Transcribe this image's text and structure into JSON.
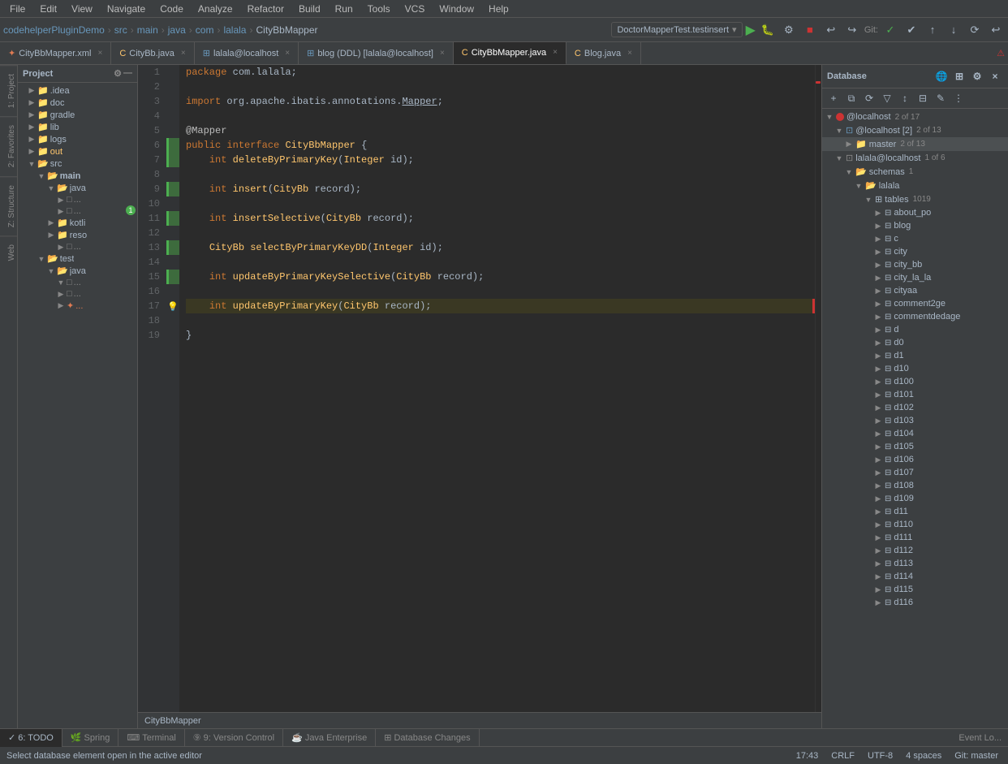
{
  "menu": {
    "items": [
      "File",
      "Edit",
      "View",
      "Navigate",
      "Code",
      "Analyze",
      "Refactor",
      "Build",
      "Run",
      "Tools",
      "VCS",
      "Window",
      "Help"
    ]
  },
  "toolbar": {
    "breadcrumbs": [
      {
        "text": "codehelperPluginDemo",
        "type": "project"
      },
      {
        "text": "src",
        "type": "folder"
      },
      {
        "text": "main",
        "type": "folder"
      },
      {
        "text": "java",
        "type": "folder"
      },
      {
        "text": "com",
        "type": "folder"
      },
      {
        "text": "lalala",
        "type": "folder"
      },
      {
        "text": "CityBbMapper",
        "type": "file"
      }
    ],
    "run_config": "DoctorMapperTest.testinsert",
    "git_label": "Git:"
  },
  "tabs": [
    {
      "label": "CityBbMapper.xml",
      "type": "xml",
      "active": false,
      "modified": false
    },
    {
      "label": "CityBb.java",
      "type": "java",
      "active": false,
      "modified": false
    },
    {
      "label": "lalala@localhost",
      "type": "db",
      "active": false,
      "modified": false
    },
    {
      "label": "blog (DDL) [lalala@localhost]",
      "type": "blog",
      "active": false,
      "modified": false
    },
    {
      "label": "CityBbMapper.java",
      "type": "java",
      "active": true,
      "modified": false
    },
    {
      "label": "Blog.java",
      "type": "java",
      "active": false,
      "modified": false
    }
  ],
  "project_tree": {
    "root": "codehelperPluginDemo",
    "items": [
      {
        "label": ".idea",
        "level": 1,
        "type": "folder",
        "expanded": false
      },
      {
        "label": "doc",
        "level": 1,
        "type": "folder",
        "expanded": false
      },
      {
        "label": "gradle",
        "level": 1,
        "type": "folder",
        "expanded": false
      },
      {
        "label": "lib",
        "level": 1,
        "type": "folder",
        "expanded": false
      },
      {
        "label": "logs",
        "level": 1,
        "type": "folder",
        "expanded": false
      },
      {
        "label": "out",
        "level": 1,
        "type": "folder",
        "expanded": false,
        "highlighted": true
      },
      {
        "label": "src",
        "level": 1,
        "type": "folder",
        "expanded": true
      },
      {
        "label": "main",
        "level": 2,
        "type": "folder",
        "expanded": true
      },
      {
        "label": "java",
        "level": 3,
        "type": "folder",
        "expanded": true
      },
      {
        "label": "...",
        "level": 4,
        "type": "file"
      },
      {
        "label": "...",
        "level": 4,
        "type": "file"
      },
      {
        "label": "kotli",
        "level": 3,
        "type": "folder",
        "expanded": false
      },
      {
        "label": "reso",
        "level": 3,
        "type": "folder",
        "expanded": false
      },
      {
        "label": "test",
        "level": 2,
        "type": "folder",
        "expanded": true
      },
      {
        "label": "java",
        "level": 3,
        "type": "folder",
        "expanded": true
      },
      {
        "label": "...",
        "level": 4,
        "type": "file"
      },
      {
        "label": "...",
        "level": 4,
        "type": "file"
      },
      {
        "label": "...",
        "level": 5,
        "type": "file"
      }
    ]
  },
  "code": {
    "filename": "CityBbMapper",
    "lines": [
      {
        "num": 1,
        "content": "package com.lalala;",
        "type": "normal",
        "gutter": ""
      },
      {
        "num": 2,
        "content": "",
        "type": "normal",
        "gutter": ""
      },
      {
        "num": 3,
        "content": "import org.apache.ibatis.annotations.Mapper;",
        "type": "normal",
        "gutter": ""
      },
      {
        "num": 4,
        "content": "",
        "type": "normal",
        "gutter": ""
      },
      {
        "num": 5,
        "content": "@Mapper",
        "type": "normal",
        "gutter": ""
      },
      {
        "num": 6,
        "content": "public interface CityBbMapper {",
        "type": "normal",
        "gutter": "change"
      },
      {
        "num": 7,
        "content": "    int deleteByPrimaryKey(Integer id);",
        "type": "normal",
        "gutter": "change"
      },
      {
        "num": 8,
        "content": "",
        "type": "normal",
        "gutter": ""
      },
      {
        "num": 9,
        "content": "    int insert(CityBb record);",
        "type": "normal",
        "gutter": "change"
      },
      {
        "num": 10,
        "content": "",
        "type": "normal",
        "gutter": ""
      },
      {
        "num": 11,
        "content": "    int insertSelective(CityBb record);",
        "type": "normal",
        "gutter": "change"
      },
      {
        "num": 12,
        "content": "",
        "type": "normal",
        "gutter": ""
      },
      {
        "num": 13,
        "content": "    CityBb selectByPrimaryKeyDD(Integer id);",
        "type": "normal",
        "gutter": "change"
      },
      {
        "num": 14,
        "content": "",
        "type": "normal",
        "gutter": ""
      },
      {
        "num": 15,
        "content": "    int updateByPrimaryKeySelective(CityBb record);",
        "type": "normal",
        "gutter": "change"
      },
      {
        "num": 16,
        "content": "",
        "type": "normal",
        "gutter": ""
      },
      {
        "num": 17,
        "content": "    int updateByPrimaryKey(CityBb record);",
        "type": "warning",
        "gutter": "warning"
      },
      {
        "num": 18,
        "content": "",
        "type": "normal",
        "gutter": ""
      },
      {
        "num": 19,
        "content": "}",
        "type": "normal",
        "gutter": ""
      }
    ]
  },
  "database_panel": {
    "title": "Database",
    "localhost_label": "@localhost",
    "localhost_count": "2 of 17",
    "localhost2_label": "@localhost [2]",
    "localhost2_count": "2 of 13",
    "master_label": "master",
    "master_count": "2 of 13",
    "lalala_host_label": "lalala@localhost",
    "lalala_host_count": "1 of 6",
    "schemas_label": "schemas",
    "schemas_count": "1",
    "lalala_schema_label": "lalala",
    "tables_label": "tables",
    "tables_count": "1019",
    "table_items": [
      "about_po",
      "blog",
      "c",
      "city",
      "city_bb",
      "city_la_la",
      "cityaa",
      "comment2ge",
      "commentdedage",
      "d",
      "d0",
      "d1",
      "d10",
      "d100",
      "d101",
      "d102",
      "d103",
      "d104",
      "d105",
      "d106",
      "d107",
      "d108",
      "d109",
      "d11",
      "d110",
      "d111",
      "d112",
      "d113",
      "d114",
      "d115",
      "d116"
    ]
  },
  "bottom_tabs": [
    {
      "label": "6: TODO",
      "icon": "check"
    },
    {
      "label": "Spring",
      "icon": "spring"
    },
    {
      "label": "Terminal",
      "icon": "terminal"
    },
    {
      "label": "9: Version Control",
      "icon": "git"
    },
    {
      "label": "Java Enterprise",
      "icon": "java"
    },
    {
      "label": "Database Changes",
      "icon": "db"
    }
  ],
  "status_bar": {
    "message": "Select database element open in the active editor",
    "position": "17:43",
    "line_ending": "CRLF",
    "encoding": "UTF-8",
    "indent": "4 spaces",
    "branch": "Git: master"
  },
  "side_labels": [
    "1: Project",
    "2: Favorites",
    "Z: Structure",
    "Web"
  ]
}
